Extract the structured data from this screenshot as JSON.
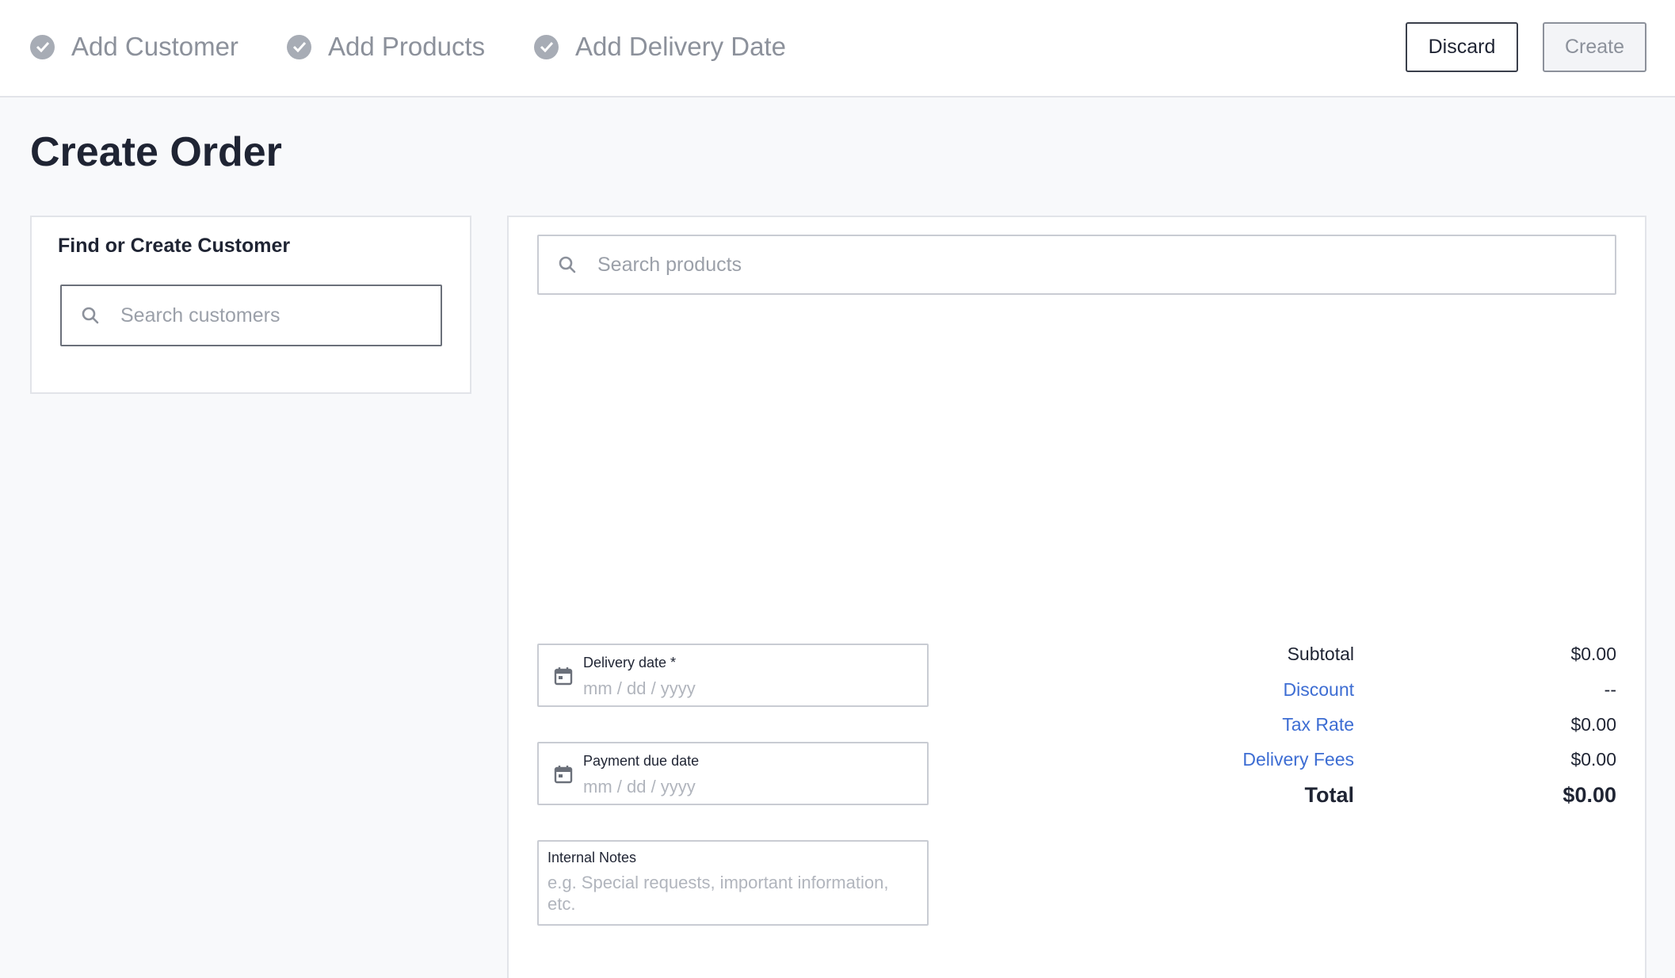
{
  "steps": [
    {
      "label": "Add Customer"
    },
    {
      "label": "Add Products"
    },
    {
      "label": "Add Delivery Date"
    }
  ],
  "actions": {
    "discard_label": "Discard",
    "create_label": "Create"
  },
  "page": {
    "title": "Create Order"
  },
  "customer": {
    "heading": "Find or Create Customer",
    "search_placeholder": "Search customers"
  },
  "products": {
    "search_placeholder": "Search products"
  },
  "dates": {
    "delivery_label": "Delivery date *",
    "delivery_placeholder": "mm / dd / yyyy",
    "payment_label": "Payment due date",
    "payment_placeholder": "mm / dd / yyyy"
  },
  "notes": {
    "label": "Internal Notes",
    "placeholder": "e.g. Special requests, important information, etc."
  },
  "summary": {
    "subtotal_label": "Subtotal",
    "subtotal_value": "$0.00",
    "discount_label": "Discount",
    "discount_value": "--",
    "tax_label": "Tax Rate",
    "tax_value": "$0.00",
    "fees_label": "Delivery Fees",
    "fees_value": "$0.00",
    "total_label": "Total",
    "total_value": "$0.00"
  },
  "colors": {
    "link": "#3d6dd3",
    "muted": "#8c919b",
    "text": "#1f2433",
    "background": "#f8f9fb"
  },
  "icons": [
    "check-circle-icon",
    "search-icon",
    "calendar-icon"
  ]
}
